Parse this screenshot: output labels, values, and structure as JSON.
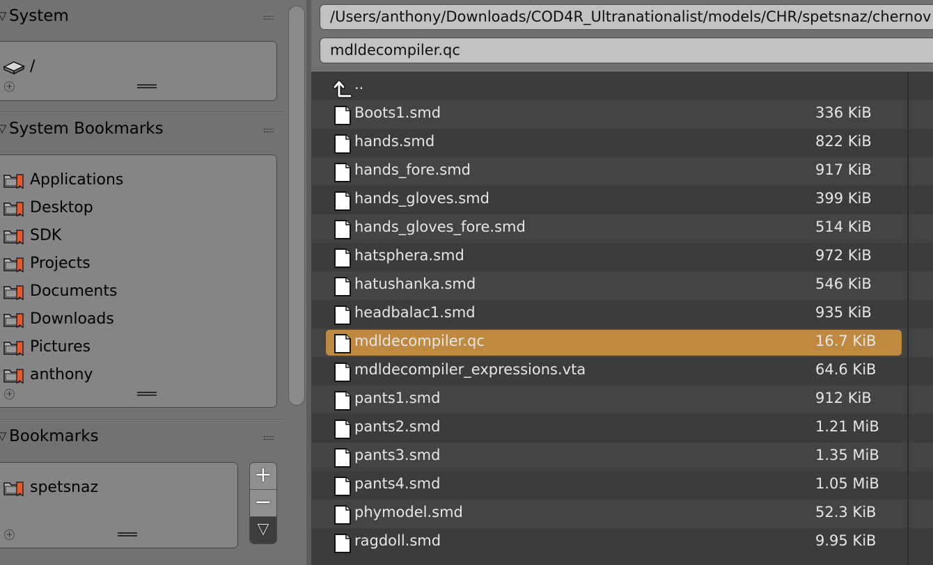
{
  "sidebar": {
    "system": {
      "title": "System",
      "items": [
        {
          "label": "/",
          "icon": "drive-icon"
        }
      ]
    },
    "system_bookmarks": {
      "title": "System Bookmarks",
      "items": [
        {
          "label": "Applications",
          "icon": "bookmark-folder-icon"
        },
        {
          "label": "Desktop",
          "icon": "bookmark-folder-icon"
        },
        {
          "label": "SDK",
          "icon": "bookmark-folder-icon"
        },
        {
          "label": "Projects",
          "icon": "bookmark-folder-icon"
        },
        {
          "label": "Documents",
          "icon": "bookmark-folder-icon"
        },
        {
          "label": "Downloads",
          "icon": "bookmark-folder-icon"
        },
        {
          "label": "Pictures",
          "icon": "bookmark-folder-icon"
        },
        {
          "label": "anthony",
          "icon": "bookmark-folder-icon"
        }
      ]
    },
    "bookmarks": {
      "title": "Bookmarks",
      "items": [
        {
          "label": "spetsnaz",
          "icon": "bookmark-folder-icon"
        }
      ],
      "add_label": "+",
      "remove_label": "−",
      "menu_label": "▽"
    }
  },
  "file_browser": {
    "path": "/Users/anthony/Downloads/COD4R_Ultranationalist/models/CHR/spetsnaz/chernov",
    "filename": "mdldecompiler.qc",
    "parent_label": "..",
    "files": [
      {
        "name": "Boots1.smd",
        "size": "336 KiB",
        "selected": false
      },
      {
        "name": "hands.smd",
        "size": "822 KiB",
        "selected": false
      },
      {
        "name": "hands_fore.smd",
        "size": "917 KiB",
        "selected": false
      },
      {
        "name": "hands_gloves.smd",
        "size": "399 KiB",
        "selected": false
      },
      {
        "name": "hands_gloves_fore.smd",
        "size": "514 KiB",
        "selected": false
      },
      {
        "name": "hatsphera.smd",
        "size": "972 KiB",
        "selected": false
      },
      {
        "name": "hatushanka.smd",
        "size": "546 KiB",
        "selected": false
      },
      {
        "name": "headbalac1.smd",
        "size": "935 KiB",
        "selected": false
      },
      {
        "name": "mdldecompiler.qc",
        "size": "16.7 KiB",
        "selected": true
      },
      {
        "name": "mdldecompiler_expressions.vta",
        "size": "64.6 KiB",
        "selected": false
      },
      {
        "name": "pants1.smd",
        "size": "912 KiB",
        "selected": false
      },
      {
        "name": "pants2.smd",
        "size": "1.21 MiB",
        "selected": false
      },
      {
        "name": "pants3.smd",
        "size": "1.35 MiB",
        "selected": false
      },
      {
        "name": "pants4.smd",
        "size": "1.05 MiB",
        "selected": false
      },
      {
        "name": "phymodel.smd",
        "size": "52.3 KiB",
        "selected": false
      },
      {
        "name": "ragdoll.smd",
        "size": "9.95 KiB",
        "selected": false
      }
    ]
  },
  "colors": {
    "selection": "#bf8a3f",
    "list_bg": "#3c3c3c",
    "list_alt": "#444444",
    "bookmark_accent": "#e8582a"
  }
}
